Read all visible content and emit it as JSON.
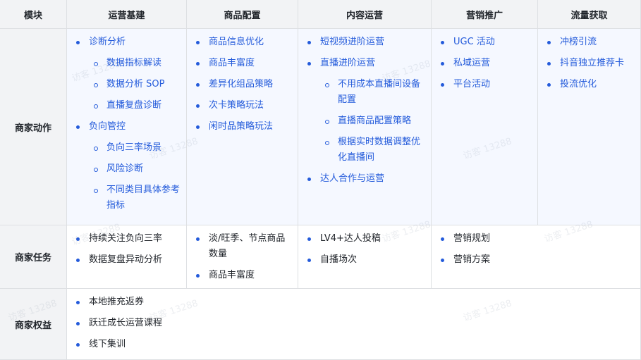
{
  "header": {
    "module": "模块",
    "columns": [
      "运营基建",
      "商品配置",
      "内容运营",
      "营销推广",
      "流量获取"
    ]
  },
  "rows": {
    "actions": {
      "label": "商家动作"
    },
    "tasks": {
      "label": "商家任务"
    },
    "benefits": {
      "label": "商家权益"
    }
  },
  "actions": {
    "ops": {
      "a": "诊断分析",
      "a1": "数据指标解读",
      "a2": "数据分析 SOP",
      "a3": "直播复盘诊断",
      "b": "负向管控",
      "b1": "负向三率场景",
      "b2": "风险诊断",
      "b3": "不同类目具体参考指标"
    },
    "goods": [
      "商品信息优化",
      "商品丰富度",
      "差异化组品策略",
      "次卡策略玩法",
      "闲时品策略玩法"
    ],
    "content": {
      "a": "短视频进阶运营",
      "b": "直播进阶运营",
      "b1": "不用成本直播间设备配置",
      "b2": "直播商品配置策略",
      "b3": "根据实时数据调整优化直播间",
      "c": "达人合作与运营"
    },
    "marketing": [
      "UGC 活动",
      "私域运营",
      "平台活动"
    ],
    "traffic": [
      "冲榜引流",
      "抖音独立推荐卡",
      "投流优化"
    ]
  },
  "tasks": {
    "ops": [
      "持续关注负向三率",
      "数据复盘异动分析"
    ],
    "goods": [
      "淡/旺季、节点商品数量",
      "商品丰富度"
    ],
    "content": [
      "LV4+达人投稿",
      "自播场次"
    ],
    "marketing": [
      "营销规划",
      "营销方案"
    ]
  },
  "benefits": [
    "本地推充返券",
    "跃迁成长运营课程",
    "线下集训"
  ],
  "watermark": "访客 13288",
  "colors": {
    "link": "#245bdb",
    "header_bg": "#f2f3f5",
    "cell_bg": "#f5f8ff",
    "border": "#dee0e3"
  }
}
